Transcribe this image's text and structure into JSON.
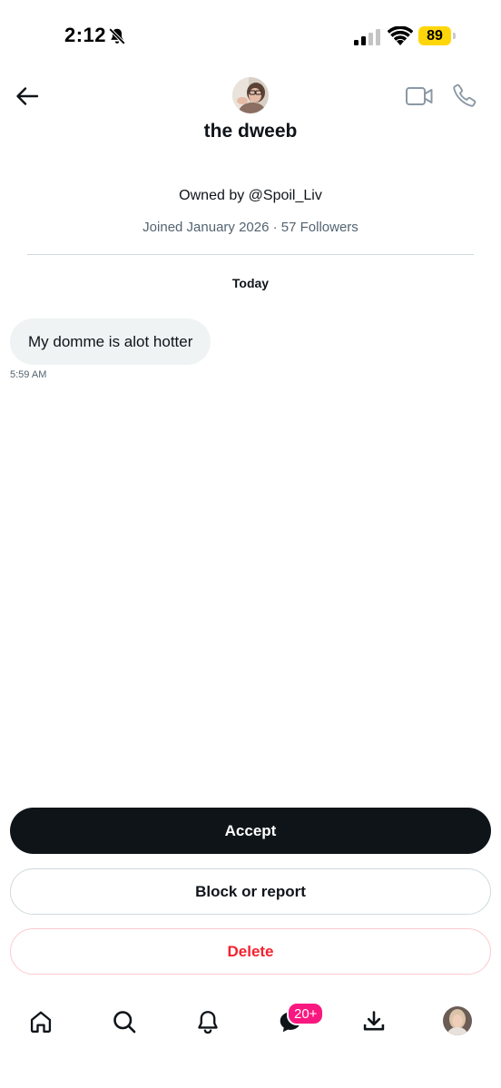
{
  "status_bar": {
    "time": "2:12",
    "battery": "89"
  },
  "header": {
    "display_name": "the dweeb"
  },
  "profile": {
    "owned_by": "Owned by @Spoil_Liv",
    "joined": "Joined January 2026 · 57 Followers"
  },
  "conversation": {
    "date_label": "Today",
    "messages": [
      {
        "text": "My domme is alot hotter",
        "time": "5:59 AM"
      }
    ]
  },
  "actions": {
    "accept_label": "Accept",
    "block_label": "Block or report",
    "delete_label": "Delete"
  },
  "bottom_nav": {
    "messages_badge": "20+",
    "items": [
      "home-icon",
      "search-icon",
      "bell-icon",
      "messages-icon",
      "download-icon",
      "profile-avatar"
    ]
  },
  "colors": {
    "primary_text": "#0f1419",
    "secondary_text": "#536471",
    "danger": "#f4212e",
    "badge": "#f91880",
    "battery": "#ffd60a",
    "bubble": "#eff3f4"
  }
}
